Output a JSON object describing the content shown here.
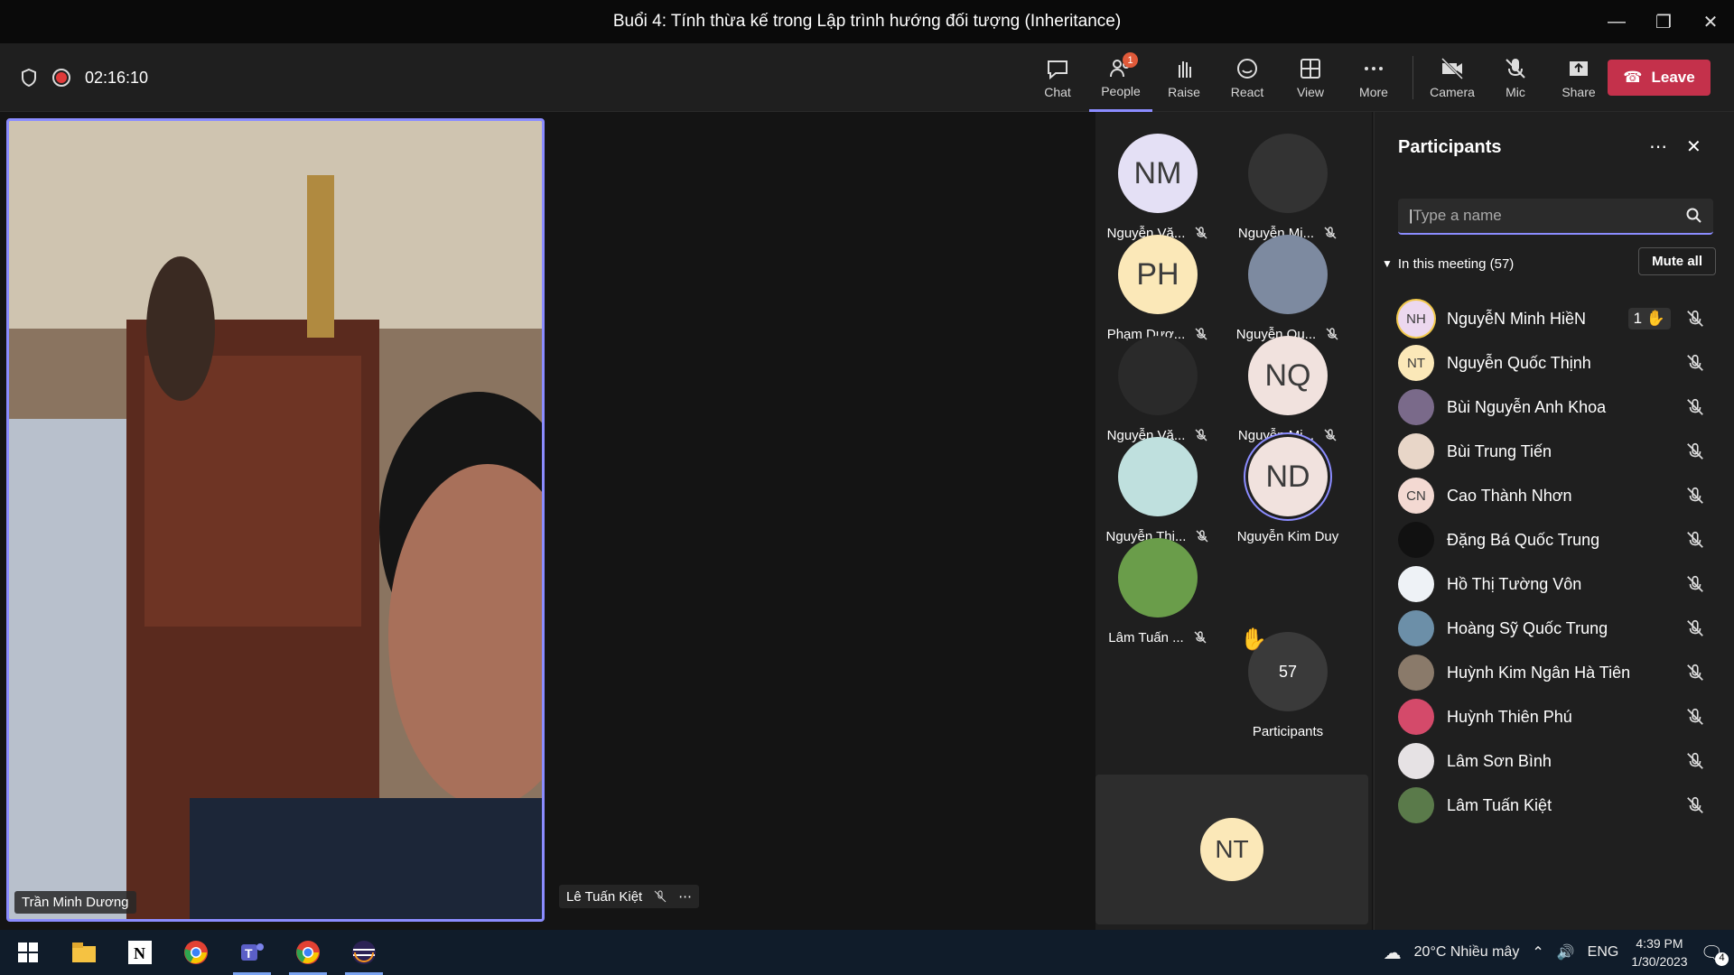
{
  "window": {
    "title": "Buổi 4: Tính thừa kế trong Lập trình hướng đối tượng (Inheritance)"
  },
  "meeting": {
    "timer": "02:16:10"
  },
  "toolbar": {
    "items": [
      {
        "label": "Chat",
        "icon": "chat-icon"
      },
      {
        "label": "People",
        "icon": "people-icon",
        "badge": "1",
        "active": true
      },
      {
        "label": "Raise",
        "icon": "hand-icon"
      },
      {
        "label": "React",
        "icon": "smile-icon"
      },
      {
        "label": "View",
        "icon": "grid-icon"
      },
      {
        "label": "More",
        "icon": "more-icon"
      },
      {
        "label": "Camera",
        "icon": "camera-off-icon"
      },
      {
        "label": "Mic",
        "icon": "mic-off-icon"
      },
      {
        "label": "Share",
        "icon": "share-icon"
      }
    ],
    "leave": "Leave"
  },
  "stage": {
    "main_name": "Trần Minh Dương",
    "second_name": "Lê Tuấn Kiệt"
  },
  "gallery": {
    "tiles": [
      {
        "initials": "NM",
        "name": "Nguyễn Vă...",
        "bg": "#e4e0f5"
      },
      {
        "initials": "",
        "name": "Nguyễn Mi...",
        "bg": "#333333"
      },
      {
        "initials": "PH",
        "name": "Phạm Dươ...",
        "bg": "#fbe8b8"
      },
      {
        "initials": "",
        "name": "Nguyễn Qu...",
        "bg": "#7d8aa0"
      },
      {
        "initials": "",
        "name": "Nguyễn Vă...",
        "bg": "#2a2a2a"
      },
      {
        "initials": "NQ",
        "name": "Nguyễn Mi...",
        "bg": "#f1e2de"
      },
      {
        "initials": "",
        "name": "Nguyễn Thị...",
        "bg": "#bfe0de"
      },
      {
        "initials": "ND",
        "name": "Nguyễn Kim Duy",
        "bg": "#f1e2de"
      },
      {
        "initials": "",
        "name": "Lâm Tuấn ...",
        "bg": "#6a9d4a"
      }
    ],
    "overflow_count": "57",
    "overflow_label": "Participants",
    "bottom_initials": "NT"
  },
  "panel": {
    "title": "Participants",
    "search_placeholder": "Type a name",
    "section": "In this meeting (57)",
    "mute_all": "Mute all",
    "people": [
      {
        "initials": "NH",
        "name": "NguyễN Minh HiềN",
        "bg": "#ecd8ef",
        "raise": "1"
      },
      {
        "initials": "NT",
        "name": "Nguyễn Quốc Thịnh",
        "bg": "#fbe8b8"
      },
      {
        "initials": "",
        "name": "Bùi Nguyễn Anh Khoa",
        "bg": "#7a6a8a"
      },
      {
        "initials": "",
        "name": "Bùi Trung Tiến",
        "bg": "#e8d6c8"
      },
      {
        "initials": "CN",
        "name": "Cao Thành Nhơn",
        "bg": "#f3d9d2"
      },
      {
        "initials": "",
        "name": "Đặng Bá Quốc Trung",
        "bg": "#111111"
      },
      {
        "initials": "",
        "name": "Hồ Thị Tường Vôn",
        "bg": "#eef2f6"
      },
      {
        "initials": "",
        "name": "Hoàng Sỹ Quốc Trung",
        "bg": "#6c8fa8"
      },
      {
        "initials": "",
        "name": "Huỳnh Kim Ngân Hà Tiên",
        "bg": "#8a7a6a"
      },
      {
        "initials": "",
        "name": "Huỳnh Thiên Phú",
        "bg": "#d44a6a"
      },
      {
        "initials": "",
        "name": "Lâm Sơn Bình",
        "bg": "#e6e2e4"
      },
      {
        "initials": "",
        "name": "Lâm Tuấn Kiệt",
        "bg": "#5a7a4a"
      }
    ]
  },
  "taskbar": {
    "weather": "20°C  Nhiều mây",
    "lang": "ENG",
    "time": "4:39 PM",
    "date": "1/30/2023",
    "notif": "4"
  }
}
